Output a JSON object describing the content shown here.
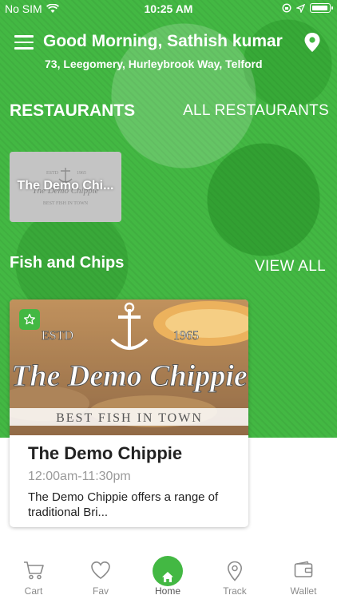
{
  "status_bar": {
    "carrier": "No SIM",
    "time": "10:25 AM"
  },
  "header": {
    "greeting": "Good Morning, Sathish kumar",
    "address": "73, Leegomery, Hurleybrook Way, Telford"
  },
  "restaurants_section": {
    "title": "RESTAURANTS",
    "link": "ALL RESTAURANTS",
    "items": [
      {
        "name": "The Demo Chi..."
      }
    ]
  },
  "category_section": {
    "title": "Fish and Chips",
    "link": "VIEW ALL",
    "featured": {
      "name": "The Demo Chippie",
      "hours": "12:00am-11:30pm",
      "description": "The Demo Chippie offers a range of traditional Bri...",
      "logo_text": {
        "estd": "ESTD",
        "year": "1965",
        "brand": "The Demo Chippie",
        "tagline": "BEST FISH IN TOWN"
      }
    }
  },
  "small_logo_text": {
    "estd": "ESTD",
    "year": "1965",
    "brand": "The Demo Chippie",
    "tagline": "BEST FISH IN TOWN"
  },
  "bottom_nav": {
    "items": [
      {
        "label": "Cart",
        "icon": "cart-icon"
      },
      {
        "label": "Fav",
        "icon": "heart-icon"
      },
      {
        "label": "Home",
        "icon": "home-icon"
      },
      {
        "label": "Track",
        "icon": "location-pin-icon"
      },
      {
        "label": "Wallet",
        "icon": "wallet-icon"
      }
    ]
  },
  "colors": {
    "accent": "#43b843",
    "text_dark": "#222222",
    "text_muted": "#9a9a9a"
  }
}
